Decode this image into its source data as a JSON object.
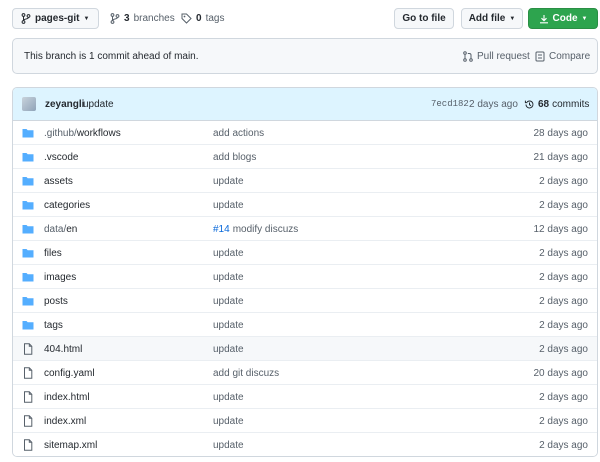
{
  "toolbar": {
    "branch_label": "pages-git",
    "branches_count": "3",
    "branches_label": "branches",
    "tags_count": "0",
    "tags_label": "tags",
    "goto_file_label": "Go to file",
    "add_file_label": "Add file",
    "code_label": "Code"
  },
  "ahead": {
    "text": "This branch is 1 commit ahead of main.",
    "pull_request_label": "Pull request",
    "compare_label": "Compare"
  },
  "commit": {
    "author": "zeyangli",
    "message": "update",
    "sha": "7ecd182",
    "age": "2 days ago",
    "count": "68",
    "count_label": "commits"
  },
  "colors": {
    "folder": "#54aeff",
    "file": "#57606a",
    "code_button": "#2da44e",
    "commit_bar": "#ddf4ff",
    "link": "#0969da"
  },
  "files": [
    {
      "type": "folder",
      "prefix": ".github/",
      "name": "workflows",
      "message": "add actions",
      "ref": "",
      "age": "28 days ago"
    },
    {
      "type": "folder",
      "prefix": "",
      "name": ".vscode",
      "message": "add blogs",
      "ref": "",
      "age": "21 days ago"
    },
    {
      "type": "folder",
      "prefix": "",
      "name": "assets",
      "message": "update",
      "ref": "",
      "age": "2 days ago"
    },
    {
      "type": "folder",
      "prefix": "",
      "name": "categories",
      "message": "update",
      "ref": "",
      "age": "2 days ago"
    },
    {
      "type": "folder",
      "prefix": "data/",
      "name": "en",
      "message": "modify discuzs",
      "ref": "#14",
      "age": "12 days ago"
    },
    {
      "type": "folder",
      "prefix": "",
      "name": "files",
      "message": "update",
      "ref": "",
      "age": "2 days ago"
    },
    {
      "type": "folder",
      "prefix": "",
      "name": "images",
      "message": "update",
      "ref": "",
      "age": "2 days ago"
    },
    {
      "type": "folder",
      "prefix": "",
      "name": "posts",
      "message": "update",
      "ref": "",
      "age": "2 days ago"
    },
    {
      "type": "folder",
      "prefix": "",
      "name": "tags",
      "message": "update",
      "ref": "",
      "age": "2 days ago"
    },
    {
      "type": "file",
      "prefix": "",
      "name": "404.html",
      "message": "update",
      "ref": "",
      "age": "2 days ago"
    },
    {
      "type": "file",
      "prefix": "",
      "name": "config.yaml",
      "message": "add git discuzs",
      "ref": "",
      "age": "20 days ago"
    },
    {
      "type": "file",
      "prefix": "",
      "name": "index.html",
      "message": "update",
      "ref": "",
      "age": "2 days ago"
    },
    {
      "type": "file",
      "prefix": "",
      "name": "index.xml",
      "message": "update",
      "ref": "",
      "age": "2 days ago"
    },
    {
      "type": "file",
      "prefix": "",
      "name": "sitemap.xml",
      "message": "update",
      "ref": "",
      "age": "2 days ago"
    }
  ]
}
